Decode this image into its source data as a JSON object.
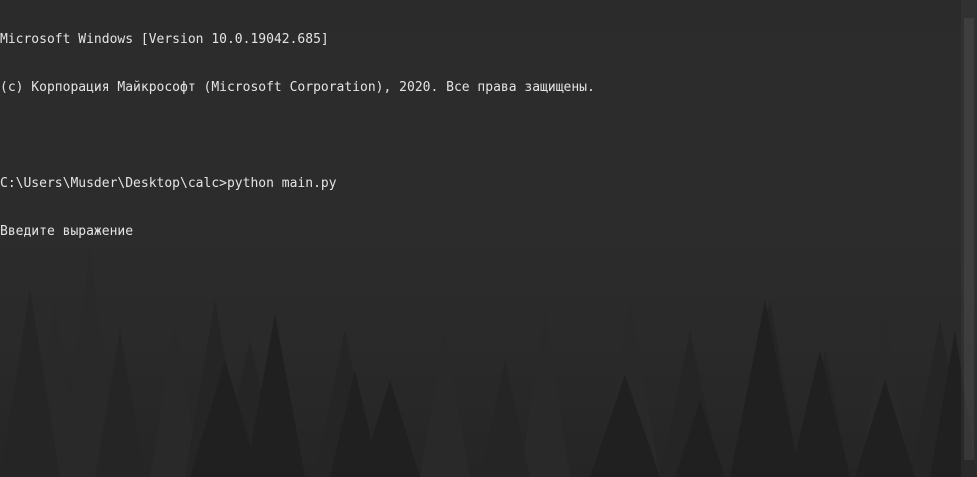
{
  "console": {
    "lines": [
      "Microsoft Windows [Version 10.0.19042.685]",
      "(c) Корпорация Майкрософт (Microsoft Corporation), 2020. Все права защищены.",
      "",
      "C:\\Users\\Musder\\Desktop\\calc>python main.py",
      "Введите выражение"
    ]
  },
  "colors": {
    "text": "#e4e4e4",
    "background": "#2b2b2b",
    "forest": "#1f1f1f"
  },
  "backdrop": {
    "icon": "misty-forest-wallpaper"
  }
}
